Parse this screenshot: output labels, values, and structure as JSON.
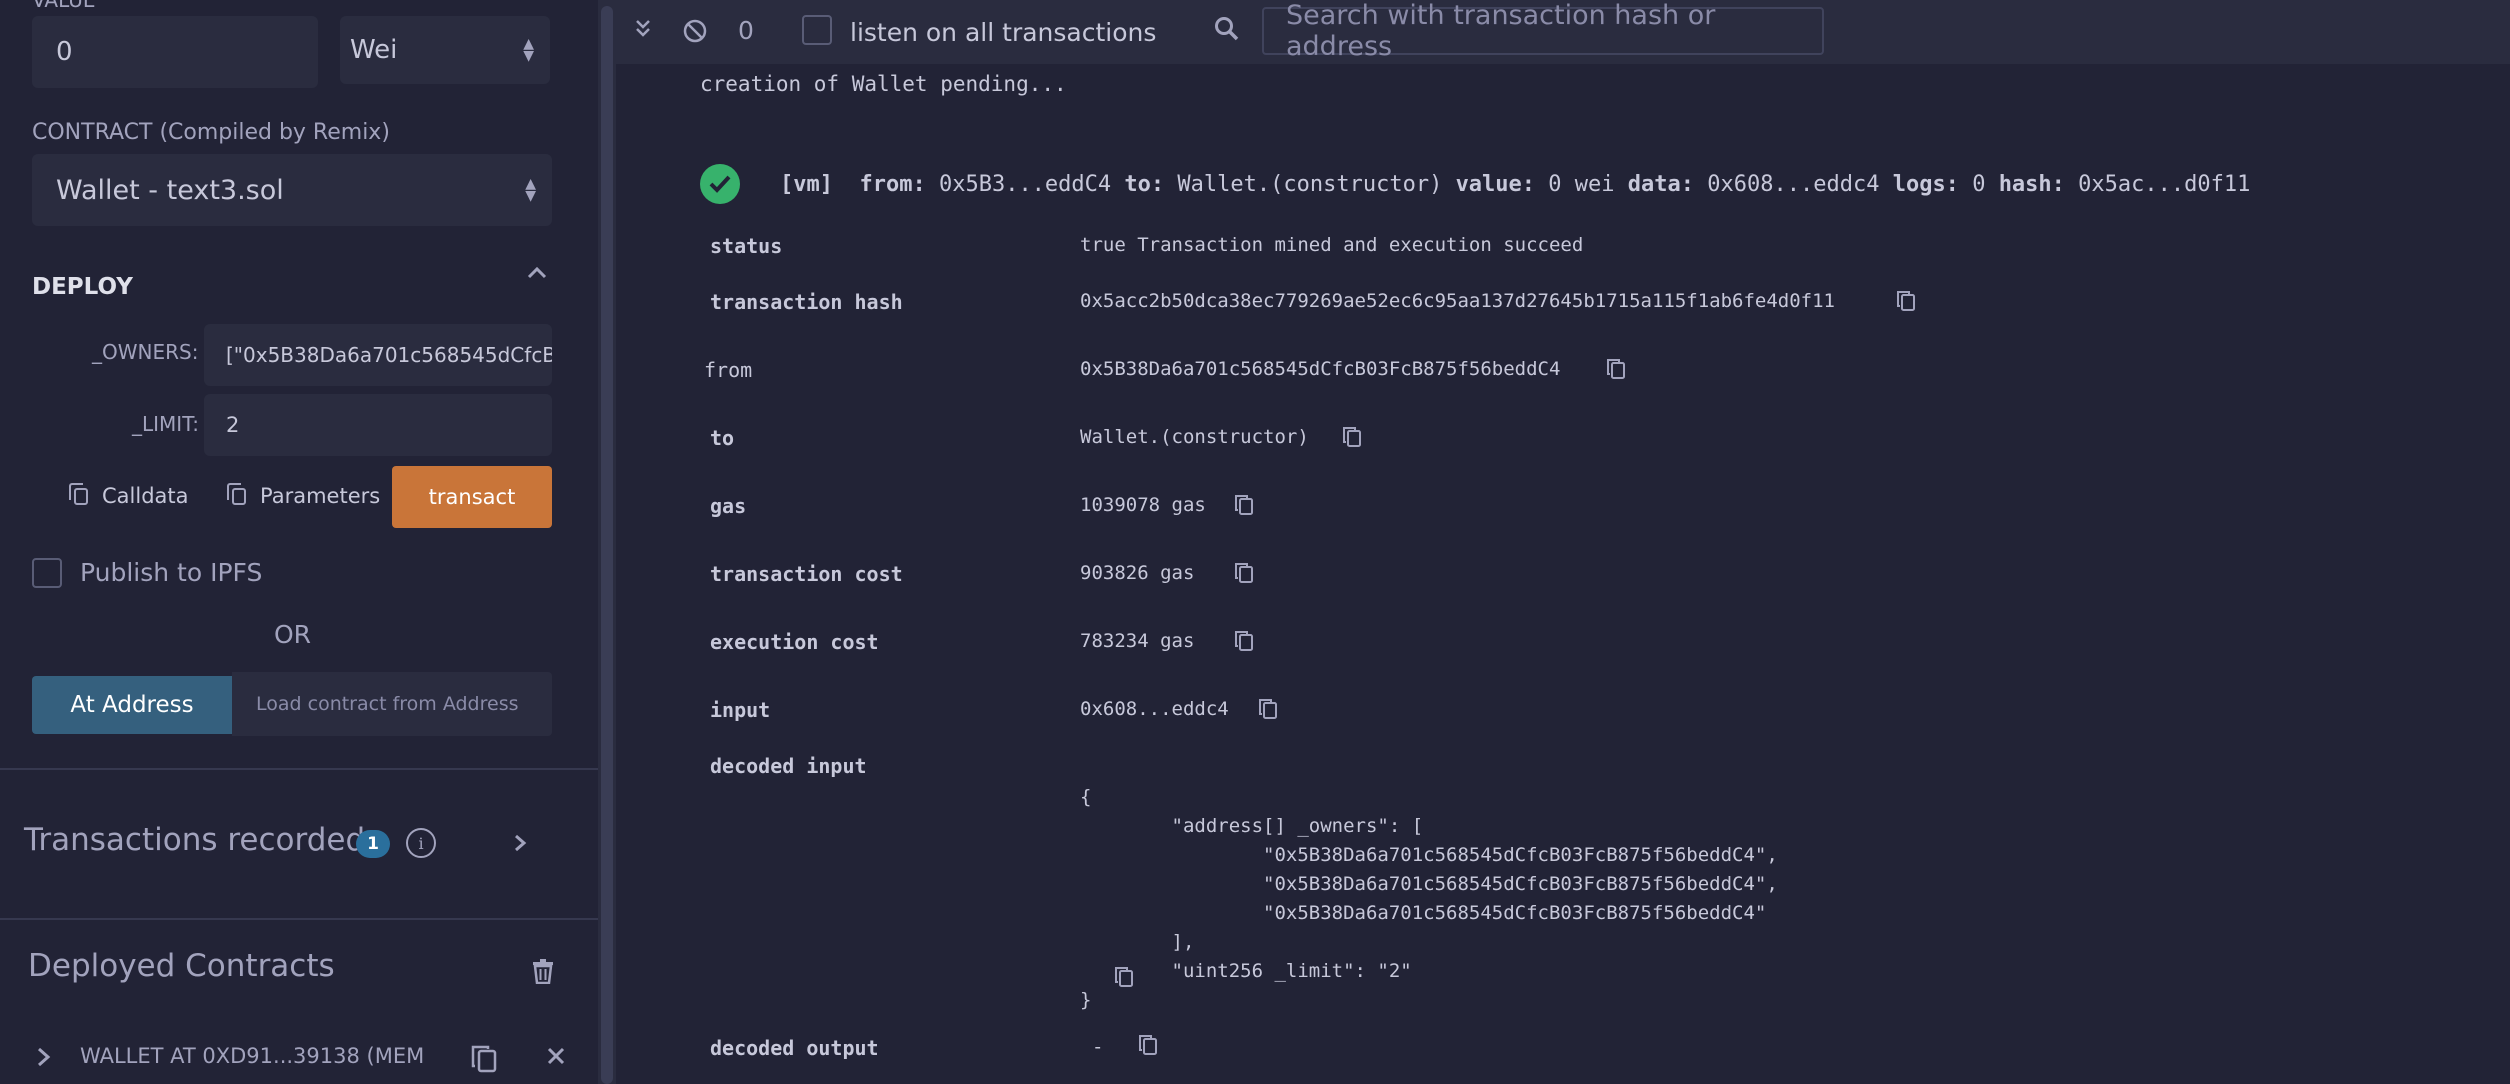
{
  "left": {
    "value_label": "VALUE",
    "value_input": "0",
    "unit_select": "Wei",
    "contract_label": "CONTRACT",
    "contract_sub": "(Compiled by Remix)",
    "contract_select": "Wallet - text3.sol",
    "deploy_title": "DEPLOY",
    "owners_label": "_OWNERS:",
    "owners_value": "[\"0x5B38Da6a701c568545dCfcB",
    "limit_label": "_LIMIT:",
    "limit_value": "2",
    "calldata_btn": "Calldata",
    "parameters_btn": "Parameters",
    "transact_btn": "transact",
    "publish_label": "Publish to IPFS",
    "or_label": "OR",
    "at_address_btn": "At Address",
    "at_address_placeholder": "Load contract from Address",
    "tx_recorded_label": "Transactions recorded",
    "tx_recorded_count": "1",
    "deployed_label": "Deployed Contracts",
    "deployed_item": "WALLET AT 0XD91...39138 (MEM"
  },
  "terminal": {
    "pending_count": "0",
    "listen_label": "listen on all transactions",
    "search_placeholder": "Search with transaction hash or address",
    "pending_msg": "creation of Wallet pending...",
    "summary": {
      "tag": "[vm]",
      "from_k": "from:",
      "from_v": "0x5B3...eddC4",
      "to_k": "to:",
      "to_v": "Wallet.(constructor)",
      "value_k": "value:",
      "value_v": "0 wei",
      "data_k": "data:",
      "data_v": "0x608...eddc4",
      "logs_k": "logs:",
      "logs_v": "0",
      "hash_k": "hash:",
      "hash_v": "0x5ac...d0f11"
    },
    "rows": {
      "status_k": "status",
      "status_v": "true Transaction mined and execution succeed",
      "hash_k": "transaction hash",
      "hash_v": "0x5acc2b50dca38ec779269ae52ec6c95aa137d27645b1715a115f1ab6fe4d0f11",
      "from_k": "from",
      "from_v": "0x5B38Da6a701c568545dCfcB03FcB875f56beddC4",
      "to_k": "to",
      "to_v": "Wallet.(constructor)",
      "gas_k": "gas",
      "gas_v": "1039078 gas",
      "txcost_k": "transaction cost",
      "txcost_v": "903826 gas",
      "execcost_k": "execution cost",
      "execcost_v": "783234 gas",
      "input_k": "input",
      "input_v": "0x608...eddc4",
      "decin_k": "decoded input",
      "decin_lines": [
        "{",
        "        \"address[] _owners\": [",
        "                \"0x5B38Da6a701c568545dCfcB03FcB875f56beddC4\",",
        "                \"0x5B38Da6a701c568545dCfcB03FcB875f56beddC4\",",
        "                \"0x5B38Da6a701c568545dCfcB03FcB875f56beddC4\"",
        "        ],",
        "        \"uint256 _limit\": \"2\"",
        "}"
      ],
      "decout_k": "decoded output",
      "decout_v": "-"
    }
  },
  "colors": {
    "bg": "#222336",
    "panel": "#2a2c3f",
    "accent": "#c97539",
    "primary": "#35607e",
    "success": "#37b26c"
  }
}
